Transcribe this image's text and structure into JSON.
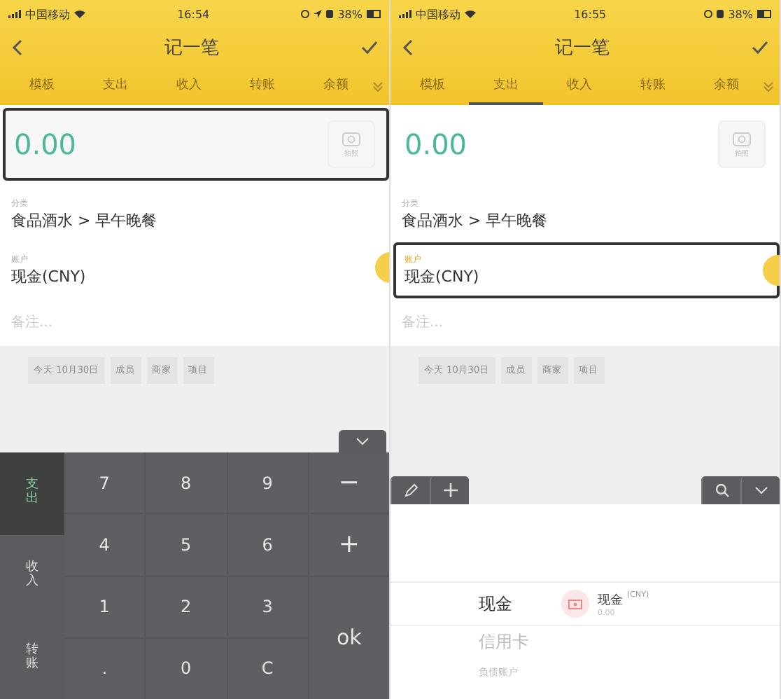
{
  "screens": [
    {
      "status": {
        "carrier": "中国移动",
        "time": "16:54",
        "battery": "38%",
        "location": true
      },
      "nav": {
        "title": "记一笔"
      },
      "tabs": [
        {
          "label": "模板",
          "selected": false
        },
        {
          "label": "支出",
          "selected": false
        },
        {
          "label": "收入",
          "selected": false
        },
        {
          "label": "转账",
          "selected": false
        },
        {
          "label": "余额",
          "selected": false
        }
      ],
      "amount": {
        "value": "0.00",
        "focused": true
      },
      "camera": {
        "label": "拍照"
      },
      "category": {
        "label": "分类",
        "value": "食品酒水 > 早午晚餐"
      },
      "account": {
        "label": "账户",
        "value": "现金(CNY)",
        "focused": false
      },
      "note": {
        "placeholder": "备注..."
      },
      "chips": [
        "今天 10月30日",
        "成员",
        "商家",
        "项目"
      ],
      "panel": {
        "kind": "keypad",
        "side": [
          {
            "label": "支出",
            "selected": true
          },
          {
            "label": "收入",
            "selected": false
          },
          {
            "label": "转账",
            "selected": false
          }
        ],
        "keys": [
          {
            "label": "7",
            "kind": "digit"
          },
          {
            "label": "8",
            "kind": "digit"
          },
          {
            "label": "9",
            "kind": "digit"
          },
          {
            "label": "−",
            "kind": "op"
          },
          {
            "label": "4",
            "kind": "digit"
          },
          {
            "label": "5",
            "kind": "digit"
          },
          {
            "label": "6",
            "kind": "digit"
          },
          {
            "label": "+",
            "kind": "op"
          },
          {
            "label": "1",
            "kind": "digit"
          },
          {
            "label": "2",
            "kind": "digit"
          },
          {
            "label": "3",
            "kind": "digit"
          },
          {
            "label": "ok",
            "kind": "ok"
          },
          {
            "label": ".",
            "kind": "digit"
          },
          {
            "label": "0",
            "kind": "digit"
          },
          {
            "label": "C",
            "kind": "digit"
          }
        ]
      }
    },
    {
      "status": {
        "carrier": "中国移动",
        "time": "16:55",
        "battery": "38%",
        "location": false
      },
      "nav": {
        "title": "记一笔"
      },
      "tabs": [
        {
          "label": "模板",
          "selected": false
        },
        {
          "label": "支出",
          "selected": true
        },
        {
          "label": "收入",
          "selected": false
        },
        {
          "label": "转账",
          "selected": false
        },
        {
          "label": "余额",
          "selected": false
        }
      ],
      "amount": {
        "value": "0.00",
        "focused": false
      },
      "camera": {
        "label": "拍照"
      },
      "category": {
        "label": "分类",
        "value": "食品酒水 > 早午晚餐"
      },
      "account": {
        "label": "账户",
        "value": "现金(CNY)",
        "focused": true
      },
      "note": {
        "placeholder": "备注..."
      },
      "chips": [
        "今天 10月30日",
        "成员",
        "商家",
        "项目"
      ],
      "panel": {
        "kind": "picker",
        "groups": [
          {
            "label": "现金",
            "selected": true
          },
          {
            "label": "信用卡",
            "selected": false
          },
          {
            "label": "负债账户",
            "selected": false
          }
        ],
        "accounts": [
          {
            "name": "现金",
            "currency": "(CNY)",
            "balance": "0.00"
          }
        ]
      }
    }
  ]
}
